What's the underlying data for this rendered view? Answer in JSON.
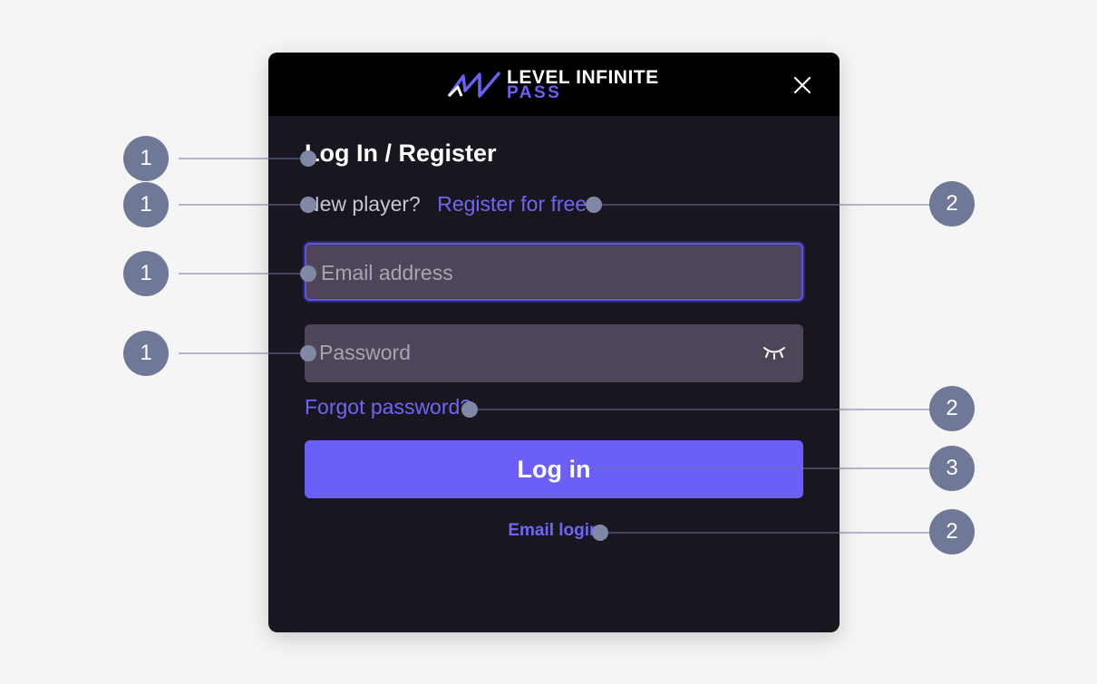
{
  "header": {
    "brand_top": "LEVEL INFINITE",
    "brand_bottom": "PASS",
    "logo_icon": "level-infinite-logo-icon",
    "close_icon": "close-icon"
  },
  "form": {
    "title": "Log In / Register",
    "new_player_text": "New player?",
    "register_link": "Register for free",
    "email_placeholder": "Email address",
    "password_placeholder": "Password",
    "password_toggle_icon": "eye-closed-icon",
    "forgot_password": "Forgot password?",
    "login_button": "Log in",
    "email_login": "Email login"
  },
  "annotations": {
    "markers": [
      "1",
      "1",
      "1",
      "1",
      "2",
      "2",
      "3",
      "2"
    ]
  },
  "colors": {
    "accent": "#6c5ff9",
    "modal_bg": "#1a1620",
    "header_bg": "#000000",
    "field_bg": "#4e4658",
    "badge": "#6f7896"
  }
}
